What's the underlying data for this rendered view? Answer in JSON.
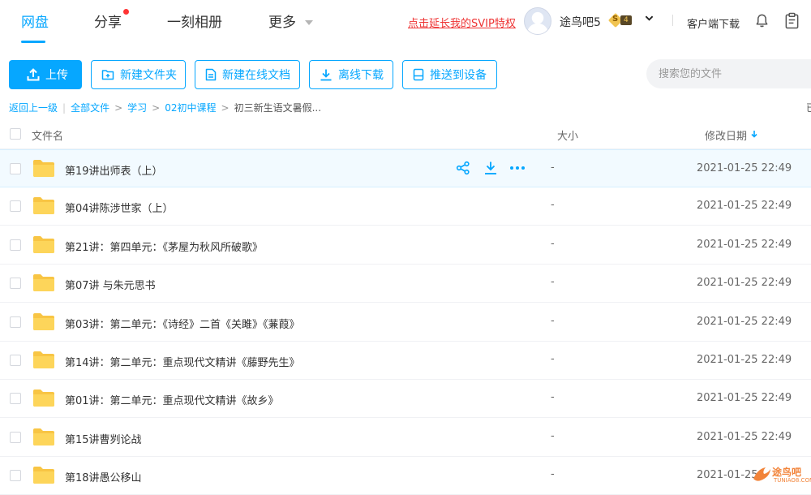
{
  "nav": {
    "tabs": [
      {
        "label": "网盘",
        "active": true
      },
      {
        "label": "分享",
        "has_dot": true
      },
      {
        "label": "一刻相册"
      },
      {
        "label": "更多"
      }
    ],
    "svip_link": "点击延长我的SVIP特权",
    "username": "途鸟吧5",
    "vip_letter": "S",
    "vip_level": "4",
    "client_download": "客户端下载",
    "accent_color": "#06a7ff",
    "icons": [
      "bell-icon",
      "clipboard-icon",
      "chevron-down-icon"
    ]
  },
  "toolbar": {
    "upload": "上传",
    "new_folder": "新建文件夹",
    "new_online_doc": "新建在线文档",
    "offline_download": "离线下载",
    "push_to_device": "推送到设备",
    "search_placeholder": "搜索您的文件"
  },
  "breadcrumb": {
    "back": "返回上一级",
    "items": [
      "全部文件",
      "学习",
      "02初中课程"
    ],
    "current": "初三新生语文暑假...",
    "edge_fragment": "已"
  },
  "list": {
    "columns": {
      "name": "文件名",
      "size": "大小",
      "modified": "修改日期"
    },
    "sort_column": "修改日期",
    "sort_order": "descending",
    "hover_row": 0,
    "rows": [
      {
        "name": "第19讲出师表（上）",
        "size": "-",
        "date": "2021-01-25 22:49"
      },
      {
        "name": "第04讲陈涉世家（上）",
        "size": "-",
        "date": "2021-01-25 22:49"
      },
      {
        "name": "第21讲：第四单元：《茅屋为秋风所破歌》",
        "size": "-",
        "date": "2021-01-25 22:49"
      },
      {
        "name": "第07讲 与朱元思书",
        "size": "-",
        "date": "2021-01-25 22:49"
      },
      {
        "name": "第03讲：第二单元：《诗经》二首《关雎》《蒹葭》",
        "size": "-",
        "date": "2021-01-25 22:49"
      },
      {
        "name": "第14讲：第二单元：重点现代文精讲《藤野先生》",
        "size": "-",
        "date": "2021-01-25 22:49"
      },
      {
        "name": "第01讲：第二单元：重点现代文精讲《故乡》",
        "size": "-",
        "date": "2021-01-25 22:49"
      },
      {
        "name": "第15讲曹刿论战",
        "size": "-",
        "date": "2021-01-25 22:49"
      },
      {
        "name": "第18讲愚公移山",
        "size": "-",
        "date": "2021-01-25"
      }
    ]
  },
  "watermark": {
    "text": "途鸟吧",
    "sub": "TUNIAO8.COM"
  }
}
